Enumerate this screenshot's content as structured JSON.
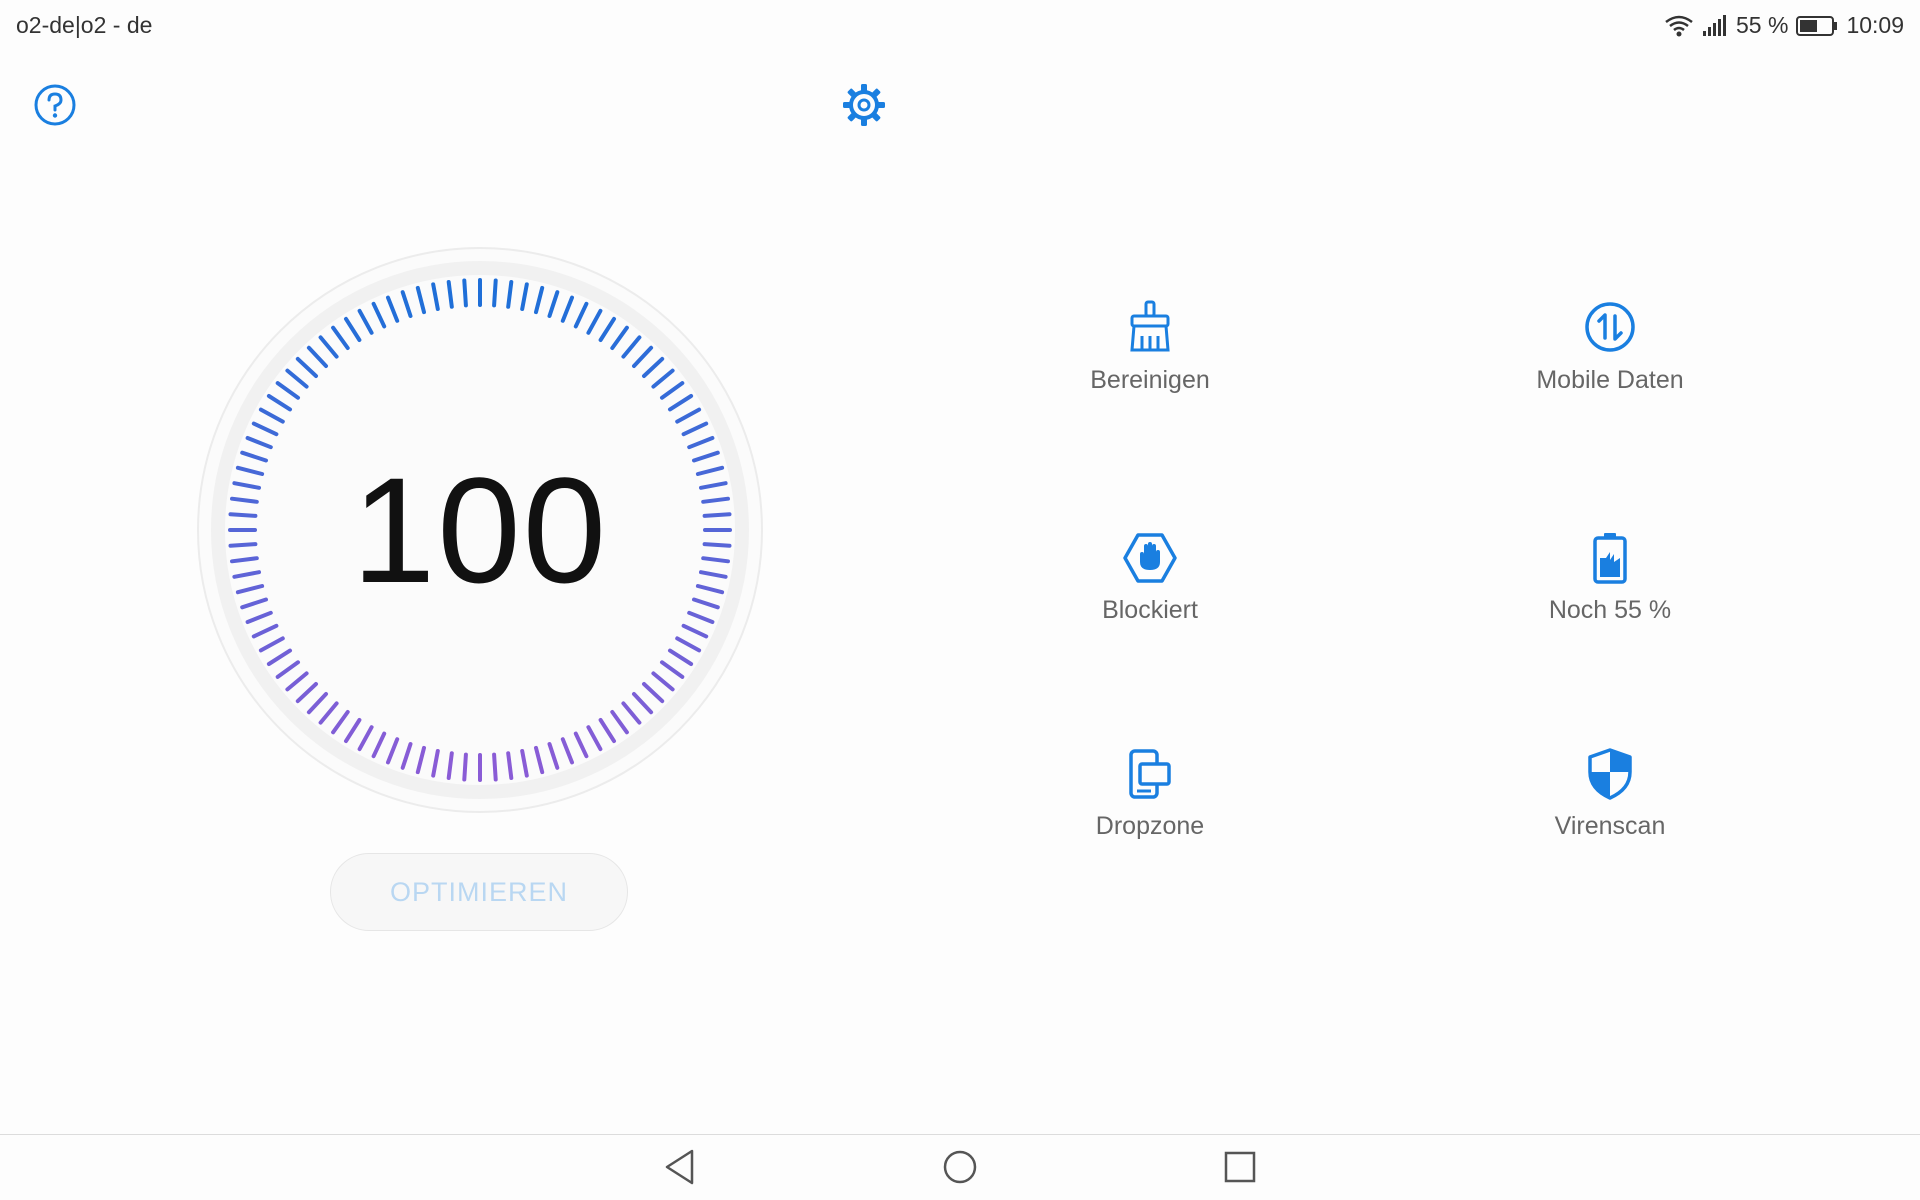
{
  "status_bar": {
    "carrier": "o2-de|o2 - de",
    "battery": "55 %",
    "time": "10:09"
  },
  "header": {
    "help_icon": "question-circle-icon",
    "settings_icon": "gear-icon"
  },
  "gauge": {
    "score": "100",
    "score_value": 100,
    "ring_colors": [
      "#1f6fd8",
      "#8a5cd6"
    ]
  },
  "optimize_label": "OPTIMIEREN",
  "features": [
    {
      "id": "cleanup",
      "icon": "broom-icon",
      "label": "Bereinigen"
    },
    {
      "id": "mobile-data",
      "icon": "data-transfer-icon",
      "label": "Mobile Daten"
    },
    {
      "id": "blocked",
      "icon": "block-hand-icon",
      "label": "Blockiert"
    },
    {
      "id": "battery",
      "icon": "battery-icon",
      "label": "Noch 55 %"
    },
    {
      "id": "dropzone",
      "icon": "dropzone-icon",
      "label": "Dropzone"
    },
    {
      "id": "virus-scan",
      "icon": "shield-icon",
      "label": "Virenscan"
    }
  ],
  "colors": {
    "accent": "#1a7fe0",
    "text": "#666666"
  }
}
